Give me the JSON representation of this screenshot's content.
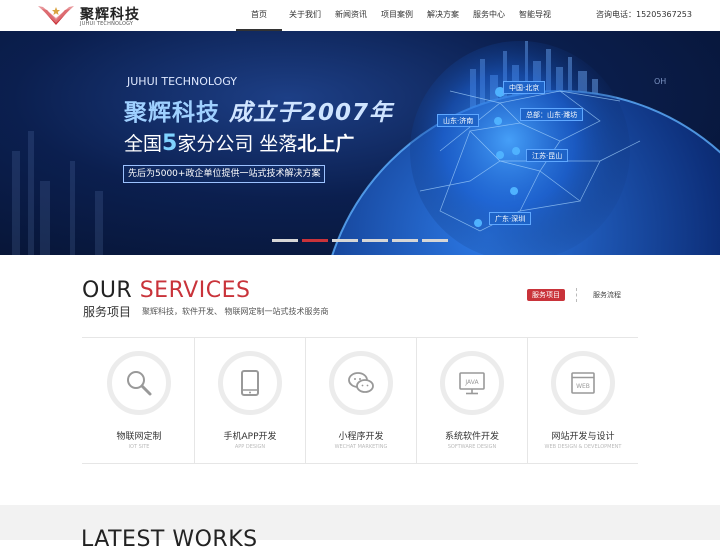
{
  "header": {
    "logo_cn": "聚辉科技",
    "logo_en": "JUHUI TECHNOLOGY",
    "nav": [
      "首页",
      "关于我们",
      "新闻资讯",
      "项目案例",
      "解决方案",
      "服务中心",
      "智能导视"
    ],
    "phone": "咨询电话：15205367253"
  },
  "banner": {
    "en_title": "JUHUI TECHNOLOGY",
    "line1_a": "聚辉科技",
    "line1_b": "成立于2007年",
    "line2_a": "全国",
    "line2_num": "5",
    "line2_b": "家分公司 坐落",
    "line2_c": "北上广",
    "tagline": "先后为5000+政企单位提供一站式技术解决方案",
    "cities": [
      "中国·北京",
      "山东·济南",
      "总部：山东·潍坊",
      "江苏·昆山",
      "广东·深圳"
    ],
    "corner": "OH",
    "slide_count": 6,
    "active_slide": 2
  },
  "services": {
    "title_a": "OUR",
    "title_b": "SERVICES",
    "subtitle": "服务项目",
    "description": "聚辉科技，软件开发、 物联网定制一站式技术服务商",
    "tabs": [
      "服务项目",
      "服务流程"
    ],
    "items": [
      {
        "title": "物联网定制",
        "en": "IOT SITE",
        "icon": "magnifier-icon"
      },
      {
        "title": "手机APP开发",
        "en": "APP DESIGN",
        "icon": "tablet-icon"
      },
      {
        "title": "小程序开发",
        "en": "WECHAT MARKETING",
        "icon": "wechat-icon"
      },
      {
        "title": "系统软件开发",
        "en": "SOFTWARE DESIGN",
        "icon": "monitor-java-icon"
      },
      {
        "title": "网站开发与设计",
        "en": "WEB DESIGN & DEVELOPMENT",
        "icon": "web-window-icon"
      }
    ]
  },
  "works": {
    "title": "LATEST WORKS"
  },
  "colors": {
    "accent": "#c9333a",
    "banner_dark": "#06122f",
    "city_tag": "#1e63c7"
  }
}
